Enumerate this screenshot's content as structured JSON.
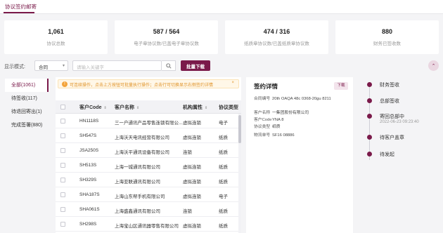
{
  "top_tab": {
    "label": "协议签约邮寄"
  },
  "stats": [
    {
      "value": "1,061",
      "label": "协议总数"
    },
    {
      "value": "587 / 564",
      "label": "电子章协议数/已盖电子章协议数"
    },
    {
      "value": "474 / 316",
      "label": "纸质章协议数/已盖纸质章协议数"
    },
    {
      "value": "880",
      "label": "财务已签收数"
    }
  ],
  "filter": {
    "mode_label": "显示模式:",
    "mode_value": "合同",
    "search_placeholder": "请输入关键字",
    "batch_download": "批量下载",
    "collapse_icon": "collapse-icon"
  },
  "nav": [
    {
      "label": "全部(1061)",
      "active": true
    },
    {
      "label": "待签收(117)",
      "active": false
    },
    {
      "label": "待退回寄出(1)",
      "active": false
    },
    {
      "label": "完成签署(880)",
      "active": false
    }
  ],
  "table": {
    "notice": "可连续操作，点击上方按钮可批量执行操作；点击行可切换显示右侧签约详情",
    "headers": {
      "code": "客户Code",
      "name": "客户名称",
      "org": "机构属性",
      "type": "协议类型"
    },
    "rows": [
      {
        "code": "HN1118S",
        "name": "三一户通讯产品零售连锁有限公...",
        "org": "虚拟连锁",
        "type": "电子"
      },
      {
        "code": "SH547S",
        "name": "上海沃天电讯经营有限公司",
        "org": "虚拟连锁",
        "type": "纸质"
      },
      {
        "code": "JSA250S",
        "name": "上海沃平通讯设备有限公司",
        "org": "连锁",
        "type": "纸质"
      },
      {
        "code": "SH513S",
        "name": "上海一城通讯有限公司",
        "org": "虚拟连锁",
        "type": "纸质"
      },
      {
        "code": "SH329S",
        "name": "上海亚联通讯有限公司",
        "org": "虚拟连锁",
        "type": "纸质"
      },
      {
        "code": "SHA187S",
        "name": "上海山东帮手机有限公司",
        "org": "虚拟连锁",
        "type": "电子"
      },
      {
        "code": "SHA061S",
        "name": "上海盛鑫通讯有限公司",
        "org": "连锁",
        "type": "纸质"
      },
      {
        "code": "SH298S",
        "name": "上海宝山区通讯器零售有限公司",
        "org": "虚拟连锁",
        "type": "纸质"
      }
    ]
  },
  "detail": {
    "title": "签约详情",
    "download": "下载",
    "fields": [
      {
        "k": "合同编号",
        "v": "20th OAQA 48c 0368-20gu 8211"
      },
      {
        "k": "客户名称",
        "v": "一集团股份有限公司"
      },
      {
        "k": "客户Code",
        "v": "YNA 8"
      },
      {
        "k": "协议类型",
        "v": "纸质"
      },
      {
        "k": "物流单号",
        "v": "SF16 08886"
      }
    ]
  },
  "timeline": [
    {
      "label": "财务签收",
      "sub": ""
    },
    {
      "label": "总部签收",
      "sub": ""
    },
    {
      "label": "寄回总部中",
      "sub": "2022-06-23 09:23:40"
    },
    {
      "label": "待客户盖章",
      "sub": ""
    },
    {
      "label": "待发起",
      "sub": ""
    }
  ],
  "colors": {
    "accent": "#7a1a4a",
    "warning": "#e0942a"
  }
}
